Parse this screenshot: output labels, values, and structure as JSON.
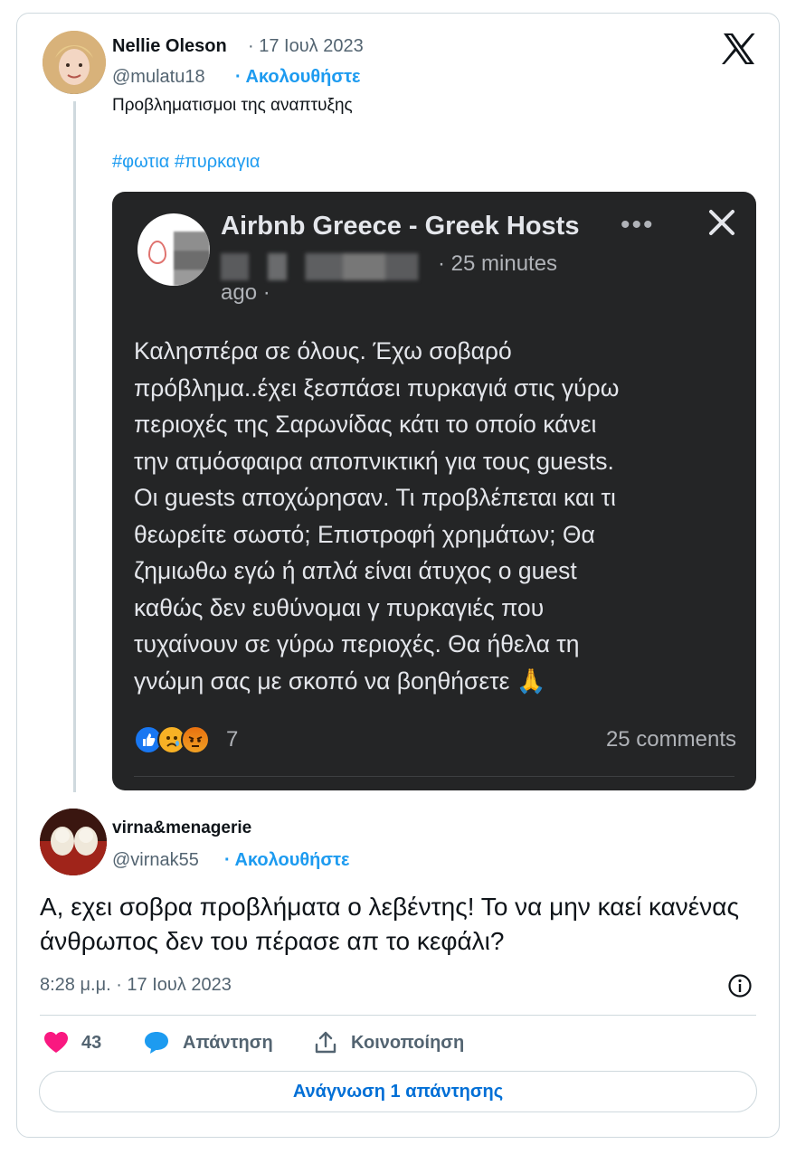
{
  "quoted_tweet": {
    "author_name": "Nellie Oleson",
    "date": "· 17 Ιουλ 2023",
    "handle": "@mulatu18",
    "follow_label": "· Ακολουθήστε",
    "text": "Προβληματισμοι της αναπτυξης",
    "hashtags": "#φωτια #πυρκαγια"
  },
  "embedded_post": {
    "group_name": "Airbnb Greece - Greek Hosts",
    "menu_glyph": "•••",
    "time_meta": "· 25 minutes",
    "time_meta_cont": "ago ·",
    "body": "Καλησπέρα σε όλους. Έχω σοβαρό\nπρόβλημα..έχει ξεσπάσει πυρκαγιά στις γύρω\nπεριοχές της Σαρωνίδας κάτι το οποίο κάνει\nτην ατμόσφαιρα αποπνικτική για τους guests.\nΟι guests αποχώρησαν. Τι προβλέπεται και τι\nθεωρείτε σωστό; Επιστροφή χρημάτων; Θα\nζημιωθω εγώ ή απλά είναι άτυχος ο guest\nκαθώς δεν ευθύνομαι γ πυρκαγιές που\nτυχαίνουν σε γύρω περιοχές. Θα ήθελα τη\nγνώμη σας με σκοπό να βοηθήσετε 🙏",
    "reaction_count": "7",
    "comments": "25 comments"
  },
  "reply_tweet": {
    "author_name": "virna&menagerie",
    "handle": "@virnak55",
    "follow_label": "· Ακολουθήστε",
    "text": "Α, εχει σοβρα προβλήματα ο λεβέντης! Το να μην καεί κανένας άνθρωπος δεν του πέρασε απ το κεφάλι?",
    "timestamp": "8:28 μ.μ. · 17 Ιουλ 2023"
  },
  "actions": {
    "like_count": "43",
    "reply_label": "Απάντηση",
    "share_label": "Κοινοποίηση"
  },
  "read_replies_label": "Ανάγνωση 1 απάντησης",
  "colors": {
    "accent": "#1d9bf0",
    "like": "#f91880",
    "dark_bg": "#242526"
  }
}
